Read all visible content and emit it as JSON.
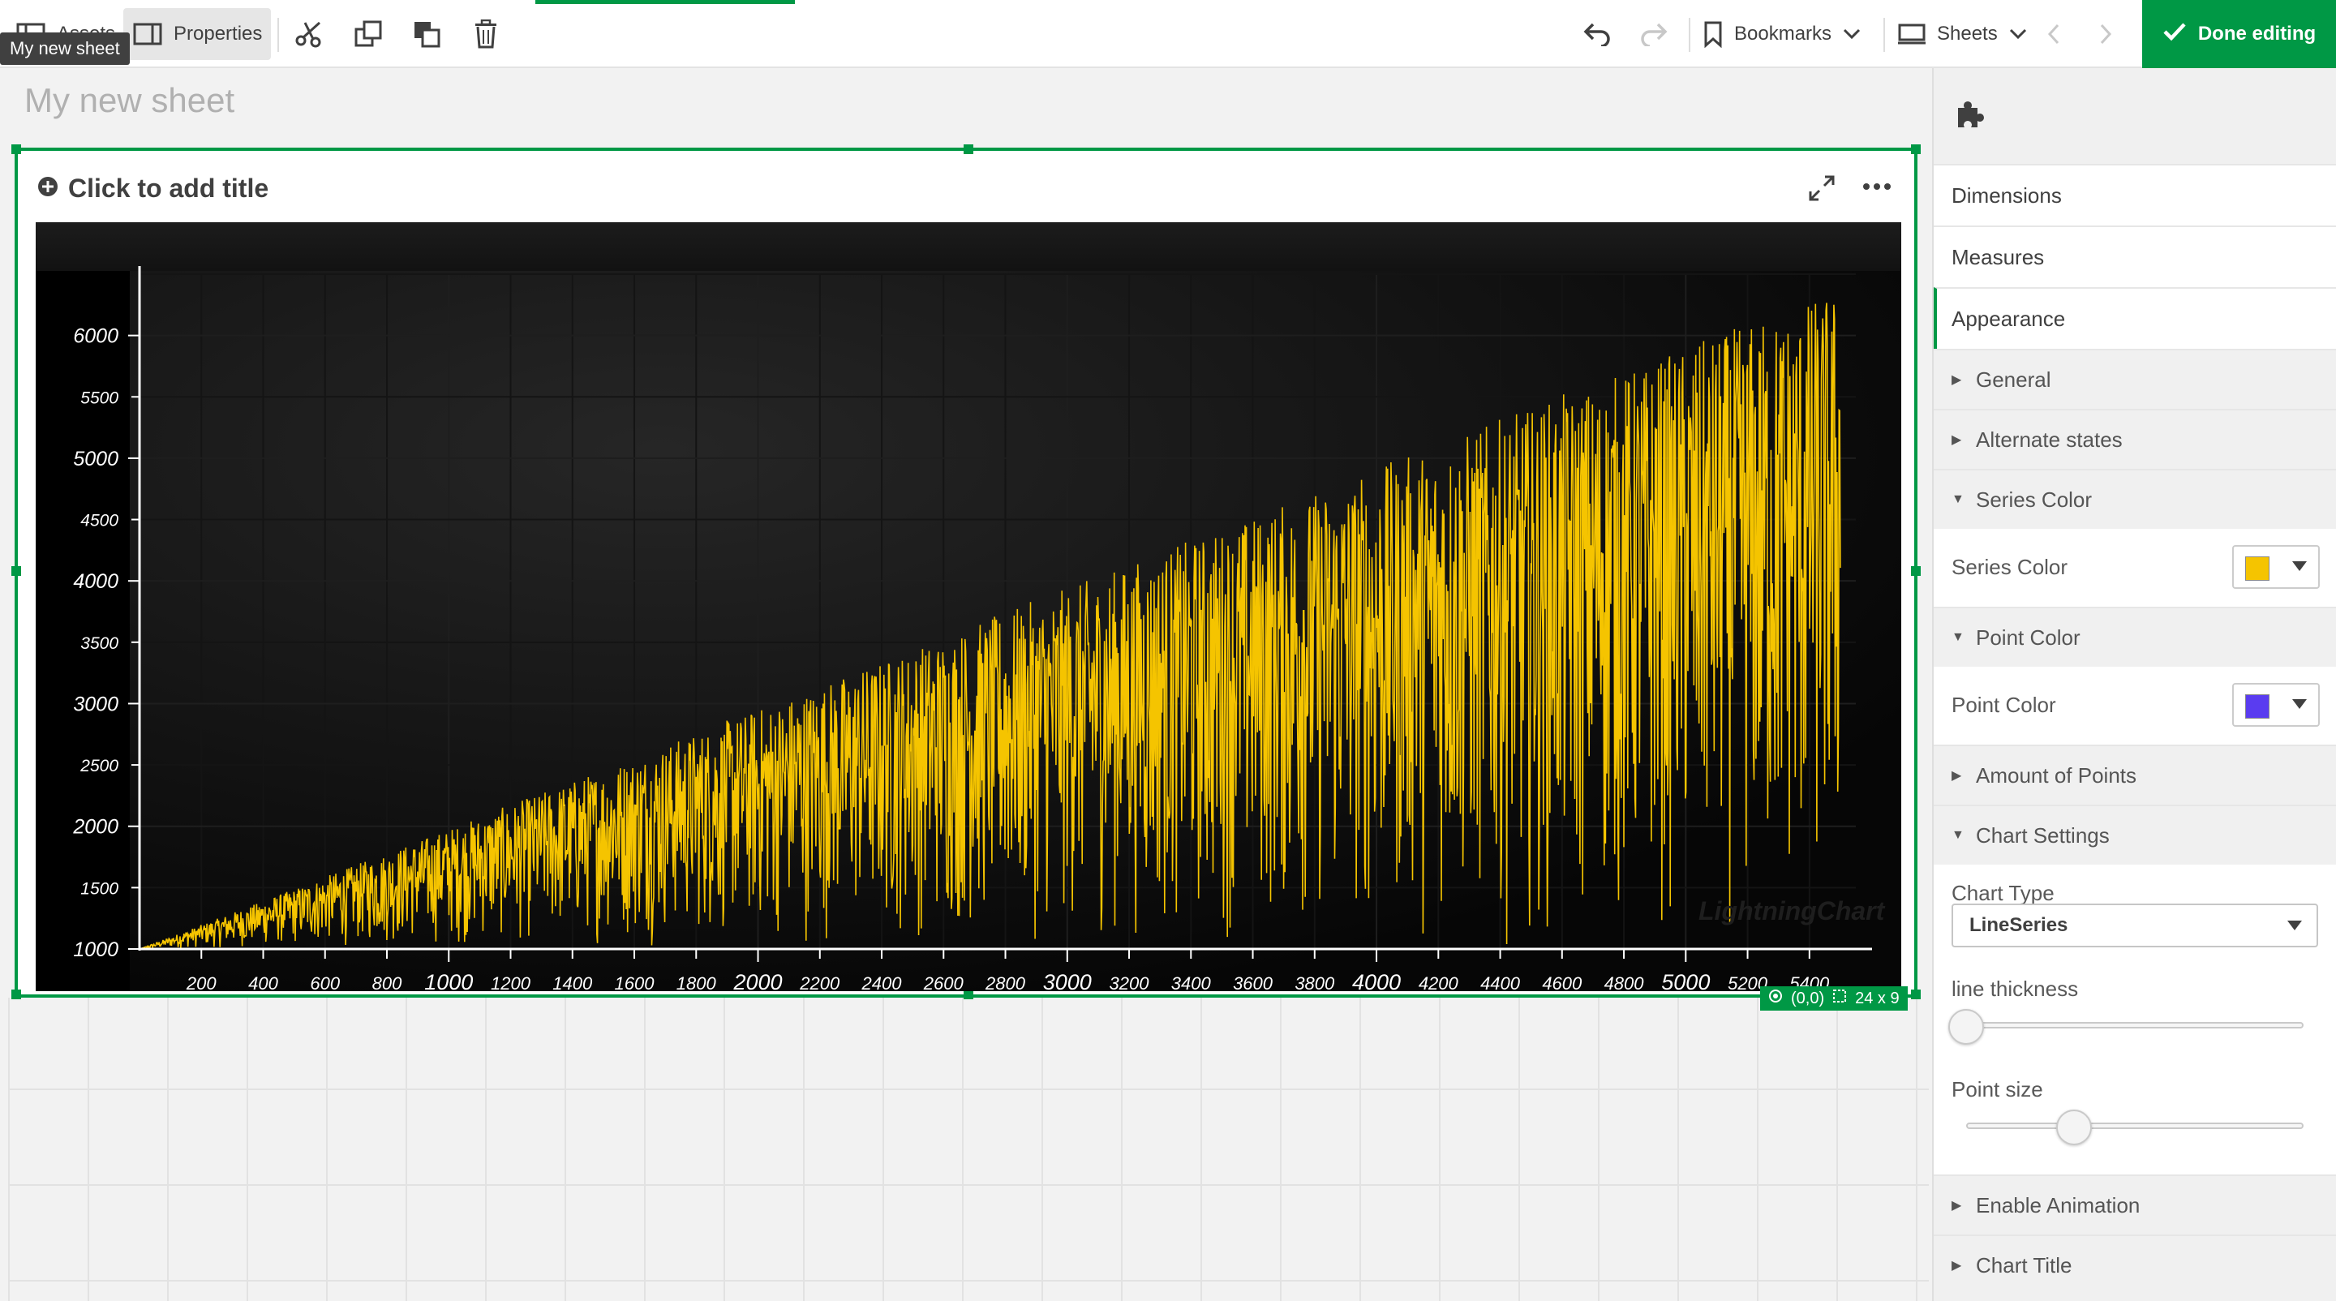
{
  "toolbar": {
    "assets_label": "Assets",
    "properties_label": "Properties",
    "tooltip": "My new sheet",
    "bookmarks_label": "Bookmarks",
    "sheets_label": "Sheets",
    "done_label": "Done editing"
  },
  "sheet": {
    "title": "My new sheet"
  },
  "chart_object": {
    "title_placeholder": "Click to add title",
    "position_badge": "(0,0)",
    "size_badge": "24 x 9",
    "watermark": "LightningChart"
  },
  "chart_data": {
    "type": "line",
    "title": "",
    "xlabel": "",
    "ylabel": "",
    "xlim": [
      0,
      5550
    ],
    "ylim": [
      1000,
      6500
    ],
    "x_ticks_minor": [
      200,
      400,
      600,
      800,
      1200,
      1400,
      1600,
      1800,
      2200,
      2400,
      2600,
      2800,
      3200,
      3400,
      3600,
      3800,
      4200,
      4400,
      4600,
      4800,
      5200,
      5400
    ],
    "x_ticks_major": [
      1000,
      2000,
      3000,
      4000,
      5000
    ],
    "y_ticks_major": [
      1000,
      2000,
      3000,
      4000,
      5000,
      6000
    ],
    "y_ticks_minor": [
      1500,
      2500,
      3500,
      4500,
      5500
    ],
    "grid": true,
    "series_color": "#f5c400",
    "series": [
      {
        "kind": "noise_envelope",
        "x_start": 0,
        "x_end": 5500,
        "y_min": 1000,
        "y_max_start": 1000,
        "y_max_end": 6400,
        "points": 5500
      }
    ]
  },
  "panel": {
    "tabs": [
      {
        "label": "Dimensions"
      },
      {
        "label": "Measures"
      },
      {
        "label": "Appearance",
        "selected": true
      }
    ],
    "general": "General",
    "alternate_states": "Alternate states",
    "series_color_section": "Series Color",
    "series_color_label": "Series Color",
    "series_color_value": "#f5c400",
    "point_color_section": "Point Color",
    "point_color_label": "Point Color",
    "point_color_value": "#5a3cf0",
    "amount_of_points": "Amount of Points",
    "chart_settings": "Chart Settings",
    "chart_type_label": "Chart Type",
    "chart_type_value": "LineSeries",
    "line_thickness_label": "line thickness",
    "line_thickness_value": 0.0,
    "point_size_label": "Point size",
    "point_size_value": 0.32,
    "enable_animation": "Enable Animation",
    "chart_title": "Chart Title"
  }
}
